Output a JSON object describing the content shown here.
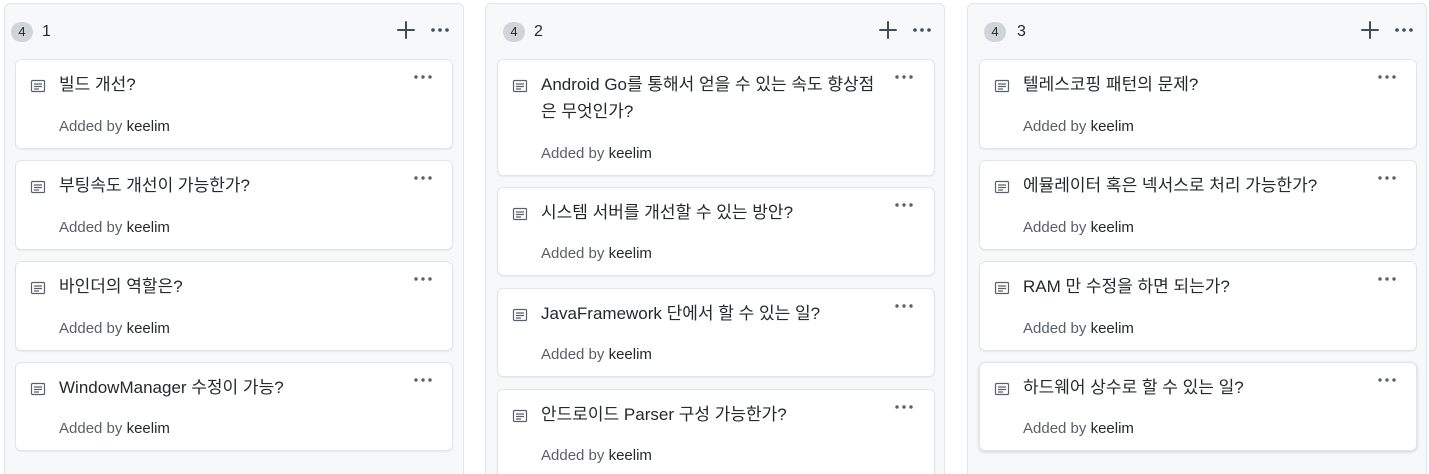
{
  "columns": [
    {
      "title": "1",
      "count": "4",
      "cards": [
        {
          "title": "빌드 개선?",
          "added_by_label": "Added by",
          "author": "keelim"
        },
        {
          "title": "부팅속도 개선이 가능한가?",
          "added_by_label": "Added by",
          "author": "keelim"
        },
        {
          "title": "바인더의 역할은?",
          "added_by_label": "Added by",
          "author": "keelim"
        },
        {
          "title": "WindowManager 수정이 가능?",
          "added_by_label": "Added by",
          "author": "keelim"
        }
      ]
    },
    {
      "title": "2",
      "count": "4",
      "cards": [
        {
          "title": "Android Go를 통해서 얻을 수 있는 속도 향상점은 무엇인가?",
          "added_by_label": "Added by",
          "author": "keelim"
        },
        {
          "title": "시스템 서버를 개선할 수 있는 방안?",
          "added_by_label": "Added by",
          "author": "keelim"
        },
        {
          "title": "JavaFramework 단에서 할 수 있는 일?",
          "added_by_label": "Added by",
          "author": "keelim"
        },
        {
          "title": "안드로이드 Parser 구성 가능한가?",
          "added_by_label": "Added by",
          "author": "keelim"
        }
      ]
    },
    {
      "title": "3",
      "count": "4",
      "cards": [
        {
          "title": "텔레스코핑 패턴의 문제?",
          "added_by_label": "Added by",
          "author": "keelim"
        },
        {
          "title": "에뮬레이터 혹은 넥서스로 처리 가능한가?",
          "added_by_label": "Added by",
          "author": "keelim"
        },
        {
          "title": "RAM 만 수정을 하면 되는가?",
          "added_by_label": "Added by",
          "author": "keelim"
        },
        {
          "title": "하드웨어 상수로 할 수 있는 일?",
          "added_by_label": "Added by",
          "author": "keelim"
        }
      ]
    }
  ],
  "icons": {
    "column_add": "plus-icon",
    "column_menu": "kebab-horizontal-icon",
    "card_type": "note-icon",
    "card_menu": "kebab-horizontal-icon"
  },
  "colors": {
    "column_background": "#f6f8fa",
    "card_background": "#ffffff",
    "border": "#e1e4e8",
    "muted_text": "#586069",
    "badge": "#d1d5da"
  }
}
